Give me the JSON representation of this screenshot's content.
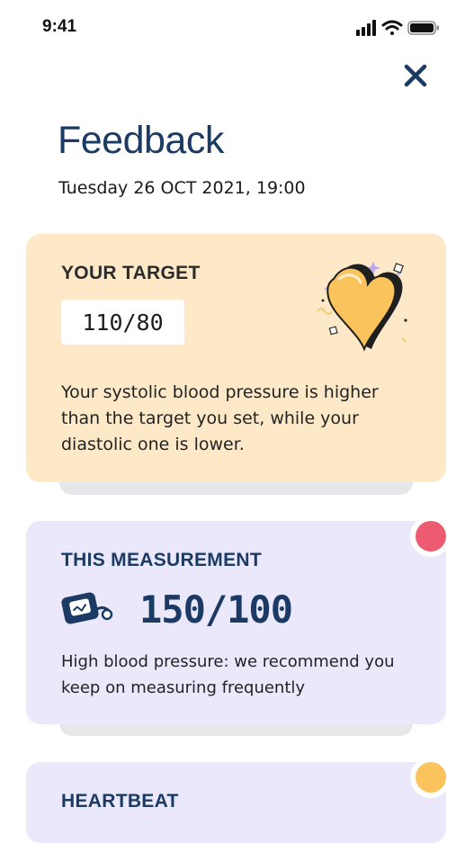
{
  "status_bar": {
    "time": "9:41"
  },
  "header": {
    "title": "Feedback",
    "date": "Tuesday 26 OCT 2021, 19:00"
  },
  "target_card": {
    "heading": "YOUR TARGET",
    "value": "110/80",
    "description": "Your systolic blood pressure is higher than the target you set, while your diastolic one is lower."
  },
  "measurement_card": {
    "heading": "THIS MEASUREMENT",
    "value": "150/100",
    "description": "High blood pressure: we recommend you keep on measuring frequently",
    "status_color": "#ec5b6f"
  },
  "heartbeat_card": {
    "heading": "HEARTBEAT",
    "status_color": "#fbc35b"
  },
  "colors": {
    "brand_navy": "#1b3a64",
    "target_card_bg": "#fde8c7",
    "measure_card_bg": "#ebe8fc",
    "heart_yellow": "#fbc35b"
  },
  "icons": {
    "close": "close-icon",
    "heart": "heart-illustration",
    "blood_pressure": "blood-pressure-monitor-icon"
  }
}
